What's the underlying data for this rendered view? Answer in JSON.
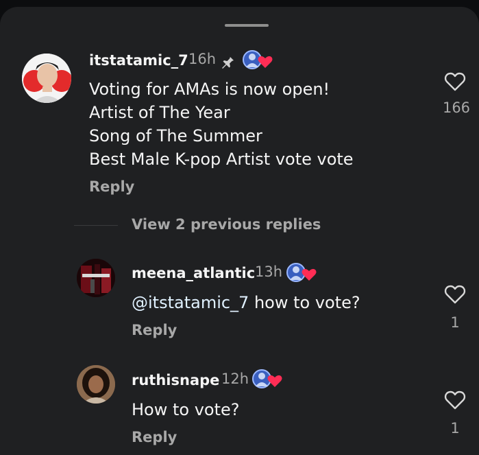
{
  "colors": {
    "background": "#1f2022",
    "primary_text": "#f5f5f5",
    "secondary_text": "#a8a8a8",
    "heart_badge": "#ff2d55",
    "mention": "#e0f1ff"
  },
  "comment": {
    "username": "itstatamic_7",
    "time": "16h",
    "pinned_icon": "pin-icon",
    "badge_icon": "fan-badge-heart-icon",
    "lines": [
      "Voting for AMAs is now open!",
      "Artist of The Year",
      "Song of The Summer",
      "Best Male K-pop Artist vote vote"
    ],
    "reply_label": "Reply",
    "like_count": "166"
  },
  "view_previous": "View 2 previous replies",
  "replies": [
    {
      "username": "meena_atlantic",
      "time": "13h",
      "mention": "@itstatamic_7",
      "text": " how to vote?",
      "reply_label": "Reply",
      "like_count": "1"
    },
    {
      "username": "ruthisnape",
      "time": "12h",
      "text": "How to vote?",
      "reply_label": "Reply",
      "like_count": "1"
    }
  ]
}
